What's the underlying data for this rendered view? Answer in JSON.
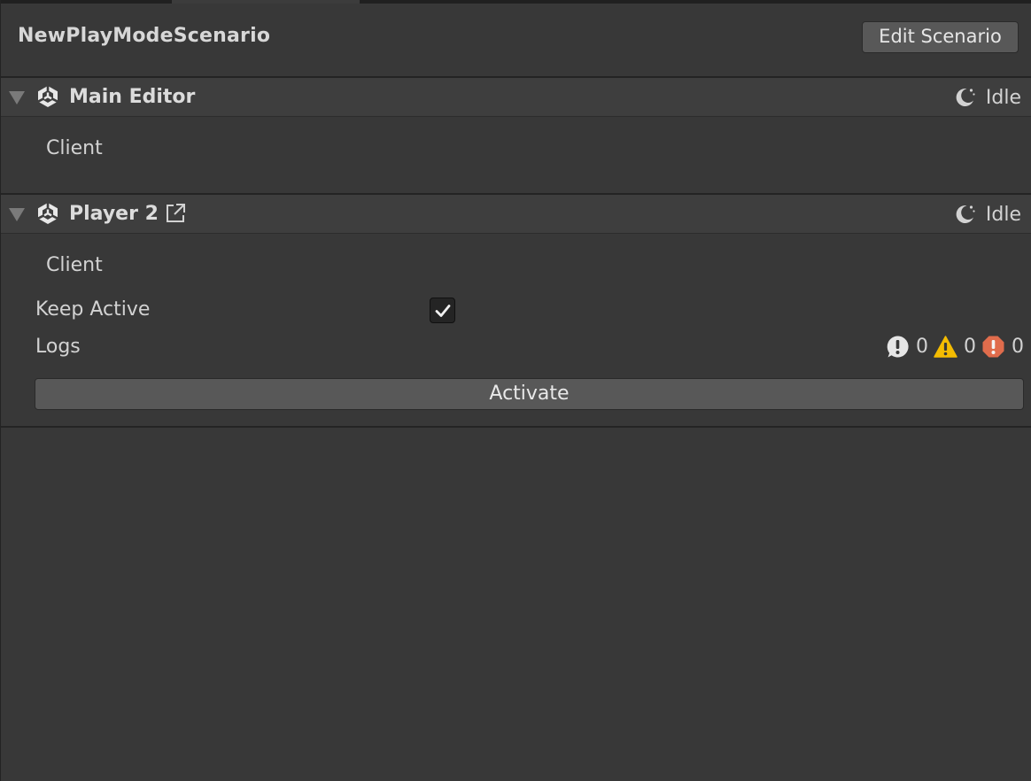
{
  "scenario": {
    "title": "NewPlayModeScenario",
    "edit_button_label": "Edit Scenario"
  },
  "instances": [
    {
      "name": "Main Editor",
      "status": "Idle",
      "role": "Client",
      "icon": "unity-icon",
      "status_icon": "moon-icon"
    },
    {
      "name": "Player 2",
      "status": "Idle",
      "role": "Client",
      "icon": "unity-icon",
      "status_icon": "moon-icon",
      "external_icon": "external-link-icon",
      "keep_active_label": "Keep Active",
      "keep_active_checked": true,
      "logs_label": "Logs",
      "logs": {
        "info_count": "0",
        "warning_count": "0",
        "error_count": "0"
      },
      "activate_label": "Activate"
    }
  ],
  "colors": {
    "background": "#383838",
    "header_background": "#3e3e3e",
    "button_background": "#585858",
    "warning": "#f4bc02",
    "error": "#e06c4c",
    "info": "#e6e6e6"
  }
}
